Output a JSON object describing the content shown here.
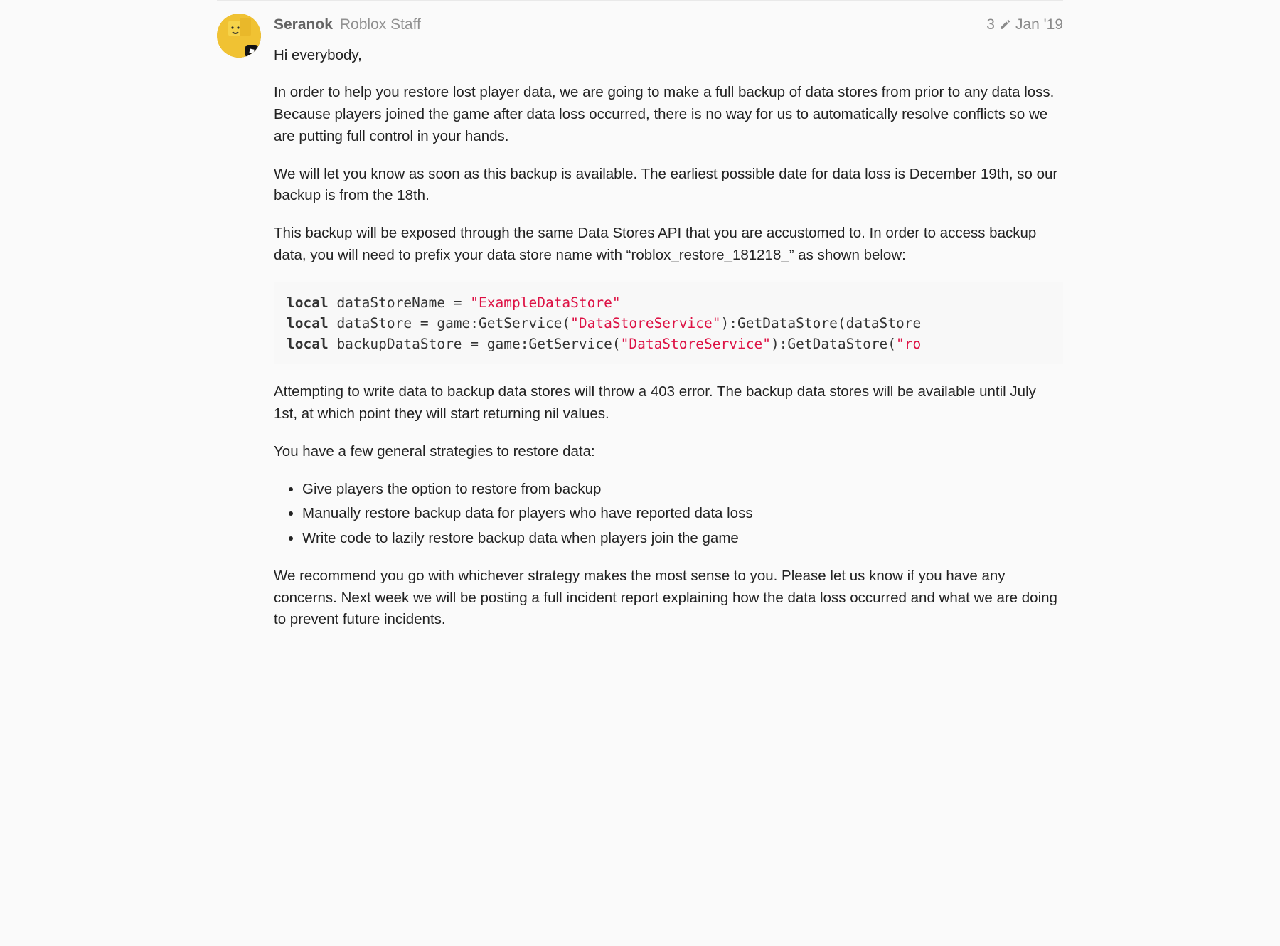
{
  "post": {
    "author": "Seranok",
    "role": "Roblox Staff",
    "edits": "3",
    "date": "Jan '19",
    "paragraphs": {
      "p1": "Hi everybody,",
      "p2": "In order to help you restore lost player data, we are going to make a full backup of data stores from prior to any data loss. Because players joined the game after data loss occurred, there is no way for us to automatically resolve conflicts so we are putting full control in your hands.",
      "p3": "We will let you know as soon as this backup is available. The earliest possible date for data loss is December 19th, so our backup is from the 18th.",
      "p4": "This backup will be exposed through the same Data Stores API that you are accustomed to. In order to access backup data, you will need to prefix your data store name with “roblox_restore_181218_” as shown below:",
      "p5": "Attempting to write data to backup data stores will throw a 403 error. The backup data stores will be available until July 1st, at which point they will start returning nil values.",
      "p6": "You have a few general strategies to restore data:",
      "p7": "We recommend you go with whichever strategy makes the most sense to you. Please let us know if you have any concerns. Next week we will be posting a full incident report explaining how the data loss occurred and what we are doing to prevent future incidents."
    },
    "code": {
      "line1": {
        "kw": "local",
        "var": " dataStoreName = ",
        "str": "\"ExampleDataStore\""
      },
      "line2": {
        "kw": "local",
        "var": " dataStore = game:GetService(",
        "str": "\"DataStoreService\"",
        "rest": "):GetDataStore(dataStore"
      },
      "line3": {
        "kw": "local",
        "var": " backupDataStore = game:GetService(",
        "str": "\"DataStoreService\"",
        "rest": "):GetDataStore(",
        "tail": "\"ro"
      }
    },
    "strategies": [
      "Give players the option to restore from backup",
      "Manually restore backup data for players who have reported data loss",
      "Write code to lazily restore backup data when players join the game"
    ]
  }
}
